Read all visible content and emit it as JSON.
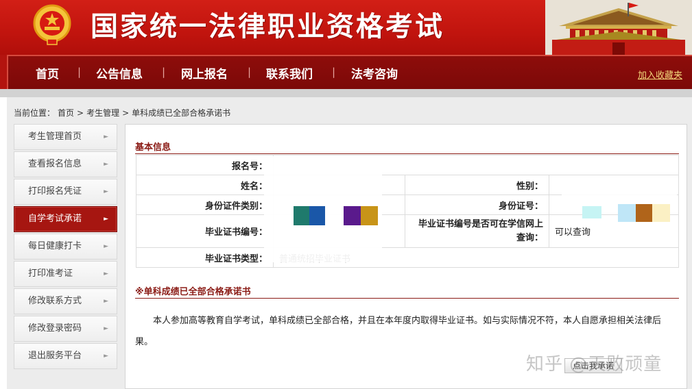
{
  "banner": {
    "site_title": "国家统一法律职业资格考试"
  },
  "nav": {
    "items": [
      "首页",
      "公告信息",
      "网上报名",
      "联系我们",
      "法考咨询"
    ],
    "separator": "|",
    "favorite": "加入收藏夹"
  },
  "breadcrumb": {
    "prefix": "当前位置：",
    "home": "首页",
    "sep": ">",
    "section": "考生管理",
    "current": "单科成绩已全部合格承诺书"
  },
  "sidebar": {
    "arrow": "►",
    "items": [
      {
        "label": "考生管理首页"
      },
      {
        "label": "查看报名信息"
      },
      {
        "label": "打印报名凭证"
      },
      {
        "label": "自学考试承诺",
        "active": true
      },
      {
        "label": "每日健康打卡"
      },
      {
        "label": "打印准考证"
      },
      {
        "label": "修改联系方式"
      },
      {
        "label": "修改登录密码"
      },
      {
        "label": "退出服务平台"
      }
    ]
  },
  "basic_info": {
    "title": "基本信息",
    "fields": {
      "reg_no_label": "报名号：",
      "name_label": "姓名：",
      "gender_label": "性别：",
      "id_type_label": "身份证件类别：",
      "id_no_label": "身份证号：",
      "cert_no_label": "毕业证书编号：",
      "cert_query_label": "毕业证书编号是否可在学信网上查询：",
      "cert_query_value": "可以查询",
      "cert_type_label": "毕业证书类型：",
      "cert_type_value": "普通统招毕业证书"
    }
  },
  "pledge": {
    "title": "※单科成绩已全部合格承诺书",
    "text": "本人参加高等教育自学考试，单科成绩已全部合格，并且在本年度内取得毕业证书。如与实际情况不符，本人自愿承担相关法律后果。",
    "button": "点击我承诺"
  },
  "watermark": "知乎 @天败顽童",
  "colors": {
    "banner_red": "#c1140e",
    "nav_dark_red": "#7c0908",
    "accent": "#8a1a14",
    "active_item": "#a61611"
  }
}
